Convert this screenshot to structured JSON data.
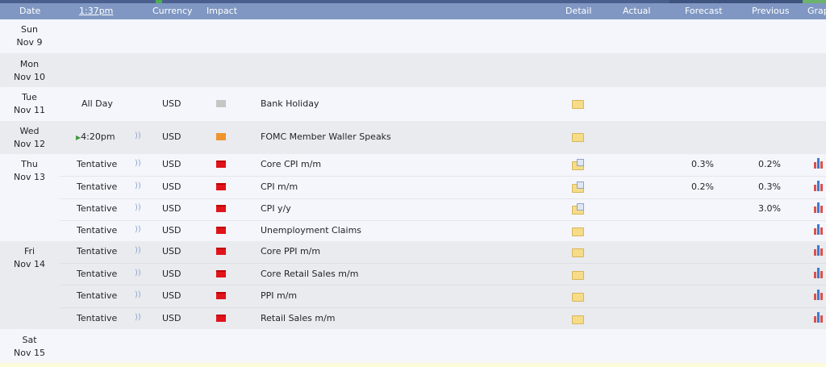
{
  "header": {
    "date": "Date",
    "time": "1:37pm",
    "currency": "Currency",
    "impact": "Impact",
    "detail": "Detail",
    "actual": "Actual",
    "forecast": "Forecast",
    "previous": "Previous",
    "graph": "Grap"
  },
  "days": {
    "sun": {
      "dow": "Sun",
      "date": "Nov 9"
    },
    "mon": {
      "dow": "Mon",
      "date": "Nov 10"
    },
    "tue": {
      "dow": "Tue",
      "date": "Nov 11"
    },
    "wed": {
      "dow": "Wed",
      "date": "Nov 12"
    },
    "thu": {
      "dow": "Thu",
      "date": "Nov 13"
    },
    "fri": {
      "dow": "Fri",
      "date": "Nov 14"
    },
    "sat": {
      "dow": "Sat",
      "date": "Nov 15"
    }
  },
  "events": [
    {
      "time": "All Day",
      "currency": "USD",
      "impact": "non-economic",
      "name": "Bank Holiday",
      "actual": "",
      "forecast": "",
      "previous": ""
    },
    {
      "time": "4:20pm",
      "currency": "USD",
      "impact": "medium",
      "name": "FOMC Member Waller Speaks",
      "actual": "",
      "forecast": "",
      "previous": ""
    },
    {
      "time": "Tentative",
      "currency": "USD",
      "impact": "high",
      "name": "Core CPI m/m",
      "actual": "",
      "forecast": "0.3%",
      "previous": "0.2%"
    },
    {
      "time": "Tentative",
      "currency": "USD",
      "impact": "high",
      "name": "CPI m/m",
      "actual": "",
      "forecast": "0.2%",
      "previous": "0.3%"
    },
    {
      "time": "Tentative",
      "currency": "USD",
      "impact": "high",
      "name": "CPI y/y",
      "actual": "",
      "forecast": "",
      "previous": "3.0%"
    },
    {
      "time": "Tentative",
      "currency": "USD",
      "impact": "high",
      "name": "Unemployment Claims",
      "actual": "",
      "forecast": "",
      "previous": ""
    },
    {
      "time": "Tentative",
      "currency": "USD",
      "impact": "high",
      "name": "Core PPI m/m",
      "actual": "",
      "forecast": "",
      "previous": ""
    },
    {
      "time": "Tentative",
      "currency": "USD",
      "impact": "high",
      "name": "Core Retail Sales m/m",
      "actual": "",
      "forecast": "",
      "previous": ""
    },
    {
      "time": "Tentative",
      "currency": "USD",
      "impact": "high",
      "name": "PPI m/m",
      "actual": "",
      "forecast": "",
      "previous": ""
    },
    {
      "time": "Tentative",
      "currency": "USD",
      "impact": "high",
      "name": "Retail Sales m/m",
      "actual": "",
      "forecast": "",
      "previous": ""
    }
  ],
  "colors": {
    "header_bg": "#7f97c2",
    "row_light": "#f4f6fb",
    "row_dark": "#e9ebef",
    "impact_high": "#e0141a",
    "impact_medium": "#f0952d",
    "impact_none": "#c6c6c6"
  },
  "icons": {
    "detail": "folder-icon",
    "detail_with_doc": "folder-doc-icon",
    "sound": "sound-wave-icon",
    "graph": "bar-graph-icon",
    "upcoming": "play-icon"
  }
}
